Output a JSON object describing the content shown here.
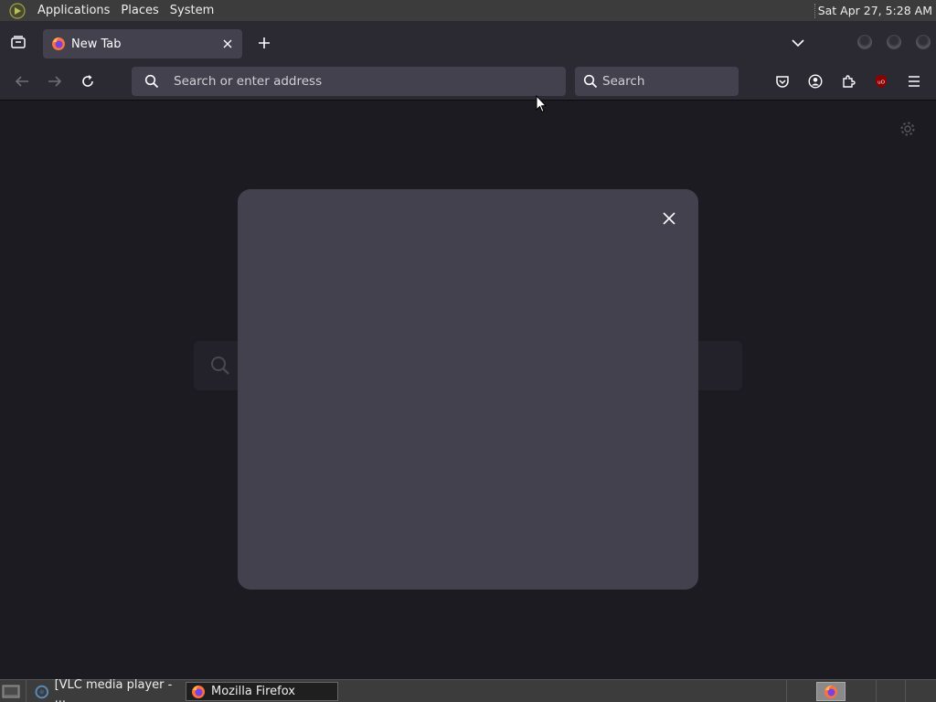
{
  "top_panel": {
    "menus": [
      "Applications",
      "Places",
      "System"
    ],
    "clock": "Sat Apr 27,  5:28 AM"
  },
  "browser": {
    "tab": {
      "title": "New Tab"
    },
    "urlbar": {
      "placeholder": "Search or enter address"
    },
    "searchbar": {
      "placeholder": "Search"
    }
  },
  "taskbar": {
    "tasks": [
      {
        "label": "[VLC media player - ..."
      },
      {
        "label": "Mozilla Firefox"
      }
    ]
  },
  "colors": {
    "toolbar_bg": "#2b2a33",
    "field_bg": "#42414d",
    "content_bg": "#1c1b22",
    "dialog_bg": "#42414d",
    "ublock_red": "#8b0000"
  },
  "icons": [
    "app-logo-icon",
    "tab-list-icon",
    "firefox-icon",
    "close-icon",
    "plus-icon",
    "chevron-down-icon",
    "back-arrow-icon",
    "forward-arrow-icon",
    "reload-icon",
    "search-icon",
    "pocket-icon",
    "account-icon",
    "extensions-icon",
    "ublock-icon",
    "hamburger-menu-icon",
    "gear-icon",
    "show-desktop-icon",
    "vlc-icon"
  ]
}
